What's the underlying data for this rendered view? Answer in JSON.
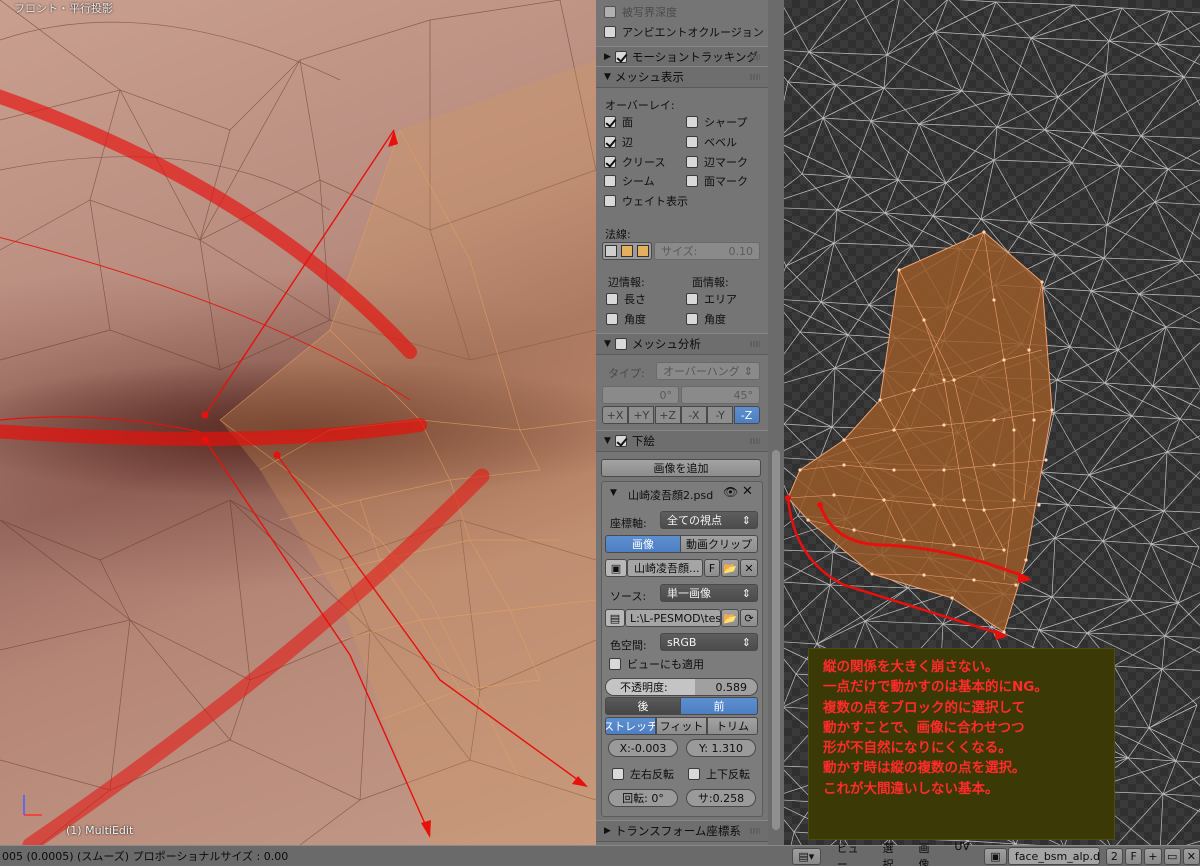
{
  "viewport": {
    "view_label": "フロント・平行投影",
    "mode_label": "(1) MultiEdit"
  },
  "panel": {
    "dof_label": "被写界深度",
    "ao_label": "アンビエントオクルージョン",
    "motion_tracking": "モーショントラッキング",
    "mesh_display": {
      "header": "メッシュ表示",
      "overlay_label": "オーバーレイ:",
      "overlays": [
        {
          "label": "面",
          "checked": true
        },
        {
          "label": "シャープ",
          "checked": false
        },
        {
          "label": "辺",
          "checked": true
        },
        {
          "label": "ベベル",
          "checked": false
        },
        {
          "label": "クリース",
          "checked": true
        },
        {
          "label": "辺マーク",
          "checked": false
        },
        {
          "label": "シーム",
          "checked": false
        },
        {
          "label": "面マーク",
          "checked": false
        },
        {
          "label": "ウェイト表示",
          "checked": false
        }
      ],
      "normals_label": "法線:",
      "size_label": "サイズ:",
      "size_value": "0.10",
      "edge_info_label": "辺情報:",
      "face_info_label": "面情報:",
      "edge_info": [
        {
          "label": "長さ",
          "checked": false
        },
        {
          "label": "角度",
          "checked": false
        }
      ],
      "face_info": [
        {
          "label": "エリア",
          "checked": false
        },
        {
          "label": "角度",
          "checked": false
        }
      ]
    },
    "mesh_analysis": {
      "header": "メッシュ分析",
      "type_label": "タイプ:",
      "type_value": "オーバーハング",
      "min_angle": "0°",
      "max_angle": "45°",
      "axes": [
        "+X",
        "+Y",
        "+Z",
        "-X",
        "-Y",
        "-Z"
      ],
      "active_axis": "-Z"
    },
    "background": {
      "header": "下絵",
      "add_image": "画像を追加",
      "image_name": "山崎凌吾顔2.psd",
      "axis_label": "座標軸:",
      "axis_value": "全ての視点",
      "tab_image": "画像",
      "tab_movie": "動画クリップ",
      "image_field": "山崎凌吾顔...",
      "image_field_flag": "F",
      "source_label": "ソース:",
      "source_value": "単一画像",
      "path_value": "L:\\L-PESMOD\\testf...",
      "colorspace_label": "色空間:",
      "colorspace_value": "sRGB",
      "view_transform_label": "ビューにも適用",
      "opacity_label": "不透明度:",
      "opacity_value": "0.589",
      "opacity_fraction": 0.589,
      "back_label": "後",
      "front_label": "前",
      "fit_modes": [
        "ストレッチ",
        "フィット",
        "トリム"
      ],
      "offset_x": "X:-0.003",
      "offset_y": "Y: 1.310",
      "flip_h": "左右反転",
      "flip_v": "上下反転",
      "rotation": "回転:  0°",
      "scale": "サ:0.258"
    },
    "transform_header": "トランスフォーム座標系"
  },
  "uv_editor": {
    "note_lines": [
      "縦の関係を大きく崩さない。",
      "一点だけで動かすのは基本的にNG。",
      "複数の点をブロック的に選択して",
      "動かすことで、画像に合わせつつ",
      "形が不自然になりにくくなる。",
      "動かす時は縦の複数の点を選択。",
      "これが大間違いしない基本。"
    ],
    "menus": [
      "ビュー",
      "選択",
      "画像",
      "UV"
    ],
    "image_name": "face_bsm_alp.dds",
    "users": "2",
    "fake_user": "F"
  },
  "status_bar": {
    "text": "005 (0.0005) (スムーズ) プロポーショナルサイズ : 0.00"
  },
  "colors": {
    "panel_bg": "#757575",
    "accent_blue": "#5587c9",
    "annotation_red": "#ff2020",
    "uv_face_fill": "#9a5a2a"
  }
}
